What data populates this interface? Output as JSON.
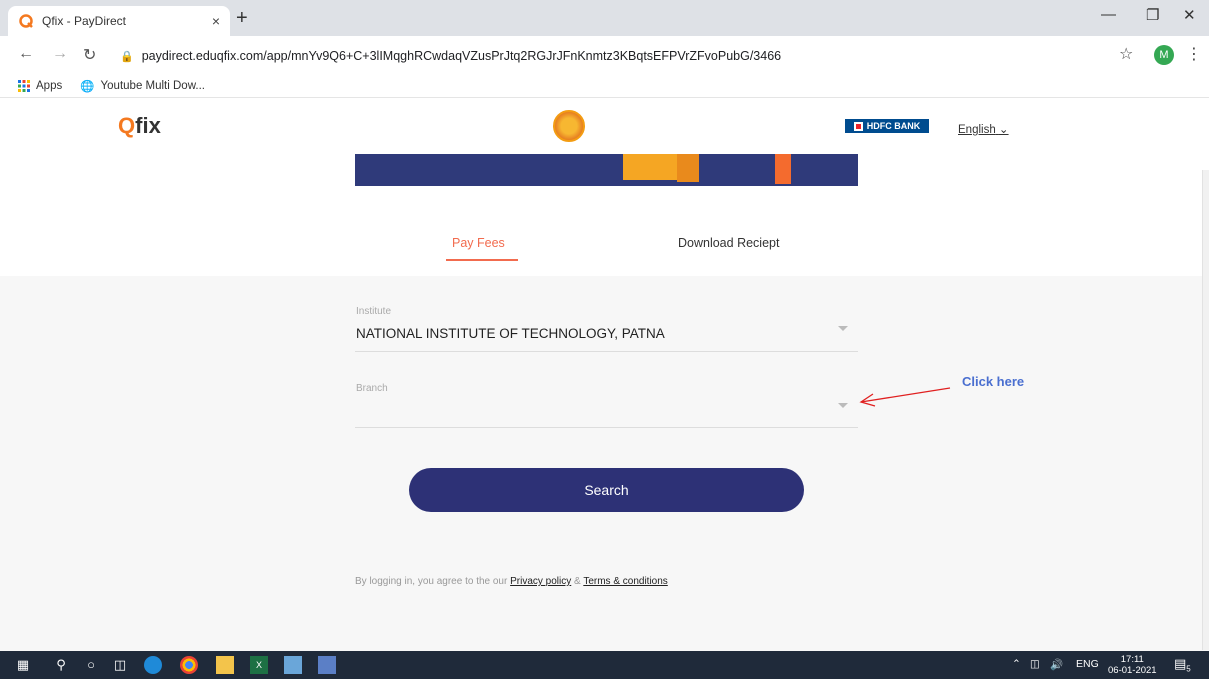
{
  "browser": {
    "tab_title": "Qfix - PayDirect",
    "tab_close": "×",
    "new_tab": "+",
    "url": "paydirect.eduqfix.com/app/mnYv9Q6+C+3lIMqghRCwdaqVZusPrJtq2RGJrJFnKnmtz3KBqtsEFPVrZFvoPubG/3466",
    "profile_initial": "M",
    "bookmarks": [
      {
        "label": "Apps"
      },
      {
        "label": "Youtube Multi Dow..."
      }
    ]
  },
  "site": {
    "logo_q": "Q",
    "logo_rest": "fix",
    "bank": "HDFC BANK",
    "language": "English",
    "tabs": [
      {
        "label": "Pay Fees",
        "active": true
      },
      {
        "label": "Download Reciept",
        "active": false
      }
    ],
    "form": {
      "institute_label": "Institute",
      "institute_value": "NATIONAL INSTITUTE OF TECHNOLOGY, PATNA",
      "branch_label": "Branch",
      "branch_value": ""
    },
    "search_label": "Search",
    "footnote": {
      "prefix": "By logging in, you agree to the our",
      "privacy": "Privacy policy",
      "amp": "&",
      "terms": "Terms & conditions"
    }
  },
  "annotation": {
    "text": "Click here",
    "color": "#4a6fd0",
    "arrow_color": "#e02020"
  },
  "taskbar": {
    "lang": "ENG",
    "time": "17:11",
    "date": "06-01-2021",
    "notif_count": "5"
  },
  "colors": {
    "accent": "#f26b4e",
    "button": "#2d3176",
    "banner": "#2f3a7a"
  }
}
